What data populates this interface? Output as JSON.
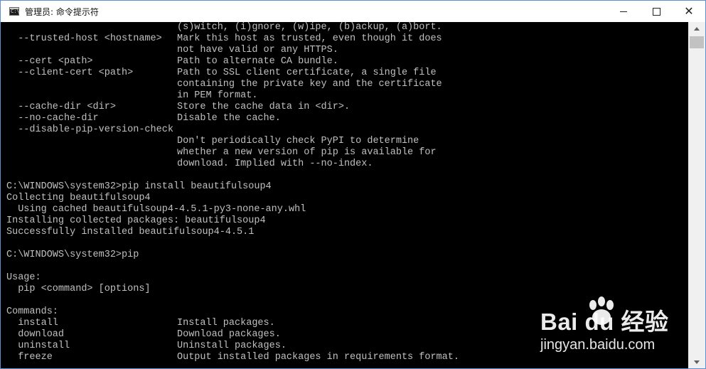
{
  "window": {
    "title": "管理员: 命令提示符",
    "icon": "cmd-icon",
    "controls": {
      "minimize": "minimize-icon",
      "maximize": "maximize-icon",
      "close": "close-icon"
    }
  },
  "console": {
    "lines": [
      {
        "cmd": "",
        "desc": "(s)witch, (i)gnore, (w)ipe, (b)ackup, (a)bort."
      },
      {
        "cmd": "  --trusted-host <hostname>",
        "desc": "Mark this host as trusted, even though it does"
      },
      {
        "cmd": "",
        "desc": "not have valid or any HTTPS."
      },
      {
        "cmd": "  --cert <path>",
        "desc": "Path to alternate CA bundle."
      },
      {
        "cmd": "  --client-cert <path>",
        "desc": "Path to SSL client certificate, a single file"
      },
      {
        "cmd": "",
        "desc": "containing the private key and the certificate"
      },
      {
        "cmd": "",
        "desc": "in PEM format."
      },
      {
        "cmd": "  --cache-dir <dir>",
        "desc": "Store the cache data in <dir>."
      },
      {
        "cmd": "  --no-cache-dir",
        "desc": "Disable the cache."
      },
      {
        "cmd": "  --disable-pip-version-check",
        "desc": ""
      },
      {
        "cmd": "",
        "desc": "Don't periodically check PyPI to determine"
      },
      {
        "cmd": "",
        "desc": "whether a new version of pip is available for"
      },
      {
        "cmd": "",
        "desc": "download. Implied with --no-index."
      },
      {
        "cmd": "",
        "desc": ""
      },
      {
        "cmd": "C:\\WINDOWS\\system32>pip install beautifulsoup4",
        "desc": ""
      },
      {
        "cmd": "Collecting beautifulsoup4",
        "desc": ""
      },
      {
        "cmd": "  Using cached beautifulsoup4-4.5.1-py3-none-any.whl",
        "desc": ""
      },
      {
        "cmd": "Installing collected packages: beautifulsoup4",
        "desc": ""
      },
      {
        "cmd": "Successfully installed beautifulsoup4-4.5.1",
        "desc": ""
      },
      {
        "cmd": "",
        "desc": ""
      },
      {
        "cmd": "C:\\WINDOWS\\system32>pip",
        "desc": ""
      },
      {
        "cmd": "",
        "desc": ""
      },
      {
        "cmd": "Usage:",
        "desc": ""
      },
      {
        "cmd": "  pip <command> [options]",
        "desc": ""
      },
      {
        "cmd": "",
        "desc": ""
      },
      {
        "cmd": "Commands:",
        "desc": ""
      },
      {
        "cmd": "  install",
        "desc": "Install packages."
      },
      {
        "cmd": "  download",
        "desc": "Download packages."
      },
      {
        "cmd": "  uninstall",
        "desc": "Uninstall packages."
      },
      {
        "cmd": "  freeze",
        "desc": "Output installed packages in requirements format."
      }
    ]
  },
  "watermark": {
    "logo": "Bai du 经验",
    "url": "jingyan.baidu.com"
  }
}
